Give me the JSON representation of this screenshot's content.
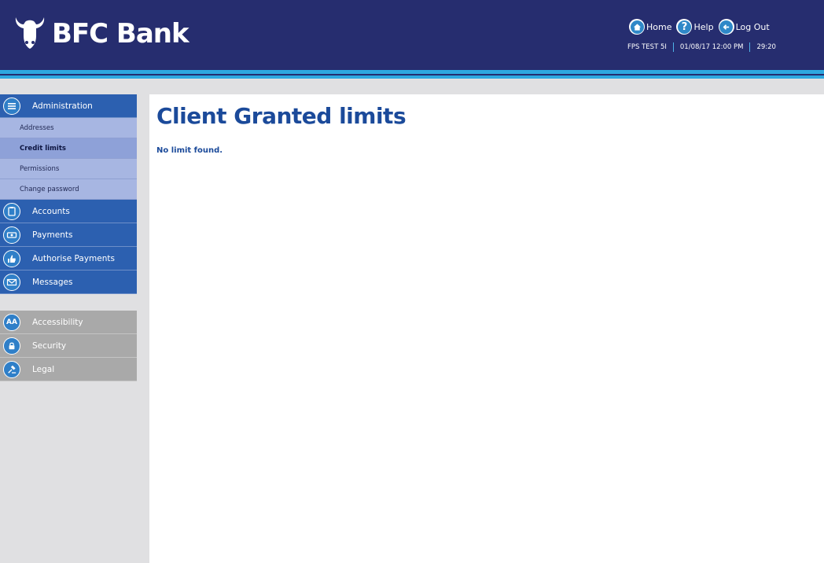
{
  "header": {
    "brand": "BFC Bank",
    "links": {
      "home": "Home",
      "help": "Help",
      "logout": "Log Out"
    },
    "session": {
      "user": "FPS TEST 5I",
      "datetime": "01/08/17 12:00 PM",
      "timer": "29:20"
    }
  },
  "sidebar": {
    "administration": {
      "label": "Administration",
      "items": [
        {
          "label": "Addresses"
        },
        {
          "label": "Credit limits",
          "active": true
        },
        {
          "label": "Permissions"
        },
        {
          "label": "Change password"
        }
      ]
    },
    "accounts": "Accounts",
    "payments": "Payments",
    "authorise_payments": "Authorise Payments",
    "messages": "Messages",
    "accessibility": "Accessibility",
    "security": "Security",
    "legal": "Legal"
  },
  "main": {
    "title": "Client Granted limits",
    "message": "No limit found."
  },
  "colors": {
    "header_bg": "#262d6f",
    "accent_stripe": "#2ea8e0",
    "menu_bg": "#2c60b0",
    "submenu_bg": "#a7b6e2",
    "util_bg": "#a9a9a9",
    "title_color": "#1b4a9a"
  }
}
